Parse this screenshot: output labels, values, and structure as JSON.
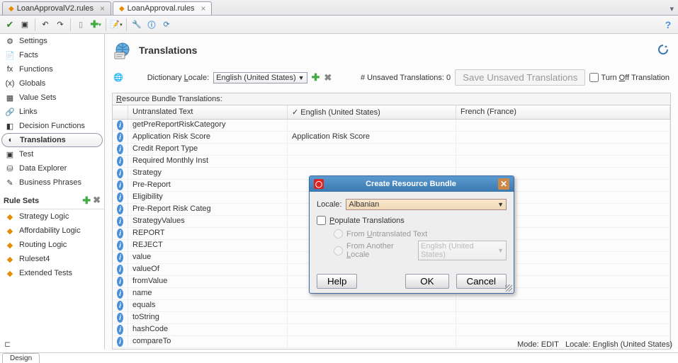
{
  "tabs": {
    "inactive": "LoanApprovalV2.rules",
    "active": "LoanApproval.rules"
  },
  "sidebar": {
    "items": [
      {
        "label": "Settings",
        "icon": "⚙"
      },
      {
        "label": "Facts",
        "icon": "📄"
      },
      {
        "label": "Functions",
        "icon": "fx"
      },
      {
        "label": "Globals",
        "icon": "(x)"
      },
      {
        "label": "Value Sets",
        "icon": "▦"
      },
      {
        "label": "Links",
        "icon": "🔗"
      },
      {
        "label": "Decision Functions",
        "icon": "◧"
      },
      {
        "label": "Translations",
        "icon": "◐"
      },
      {
        "label": "Test",
        "icon": "▣"
      },
      {
        "label": "Data Explorer",
        "icon": "⛁"
      },
      {
        "label": "Business Phrases",
        "icon": "✎"
      }
    ],
    "rulesets_head": "Rule Sets",
    "rulesets": [
      "Strategy Logic",
      "Affordability Logic",
      "Routing Logic",
      "Ruleset4",
      "Extended Tests"
    ]
  },
  "header": {
    "title": "Translations",
    "locale_label_pre": "Dictionary ",
    "locale_label_key": "L",
    "locale_label_post": "ocale:",
    "locale_value": "English (United States)",
    "unsaved_label": "# Unsaved Translations: ",
    "unsaved_count": "0",
    "save_btn": "Save Unsaved Translations",
    "turnoff_pre": "Turn ",
    "turnoff_key": "O",
    "turnoff_post": "ff Translation"
  },
  "table": {
    "title_key": "R",
    "title_rest": "esource Bundle Translations:",
    "col1": "Untranslated Text",
    "col2": "✓ English (United States)",
    "col3": "French (France)",
    "rows": [
      {
        "t": "getPreReportRiskCategory",
        "en": ""
      },
      {
        "t": "Application Risk Score",
        "en": "Application Risk Score"
      },
      {
        "t": "Credit Report Type",
        "en": ""
      },
      {
        "t": "Required Monthly Inst",
        "en": ""
      },
      {
        "t": "Strategy",
        "en": ""
      },
      {
        "t": "Pre-Report",
        "en": ""
      },
      {
        "t": "Eligibility",
        "en": ""
      },
      {
        "t": "Pre-Report Risk Categ",
        "en": ""
      },
      {
        "t": "StrategyValues",
        "en": ""
      },
      {
        "t": "REPORT",
        "en": ""
      },
      {
        "t": "REJECT",
        "en": ""
      },
      {
        "t": "value",
        "en": ""
      },
      {
        "t": "valueOf",
        "en": ""
      },
      {
        "t": "fromValue",
        "en": ""
      },
      {
        "t": "name",
        "en": ""
      },
      {
        "t": "equals",
        "en": ""
      },
      {
        "t": "toString",
        "en": ""
      },
      {
        "t": "hashCode",
        "en": ""
      },
      {
        "t": "compareTo",
        "en": ""
      }
    ]
  },
  "dialog": {
    "title": "Create Resource Bundle",
    "locale_label": "Locale:",
    "locale_value": "Albanian",
    "populate_key": "P",
    "populate_rest": "opulate Translations",
    "radio1_pre": "From ",
    "radio1_key": "U",
    "radio1_post": "ntranslated Text",
    "radio2_pre": "From Another ",
    "radio2_key": "L",
    "radio2_post": "ocale",
    "radio2_value": "English (United States)",
    "help": "Help",
    "ok": "OK",
    "cancel": "Cancel"
  },
  "status": {
    "mode": "Mode: EDIT",
    "locale": "Locale: English (United States)"
  },
  "bottom_tab": "Design"
}
